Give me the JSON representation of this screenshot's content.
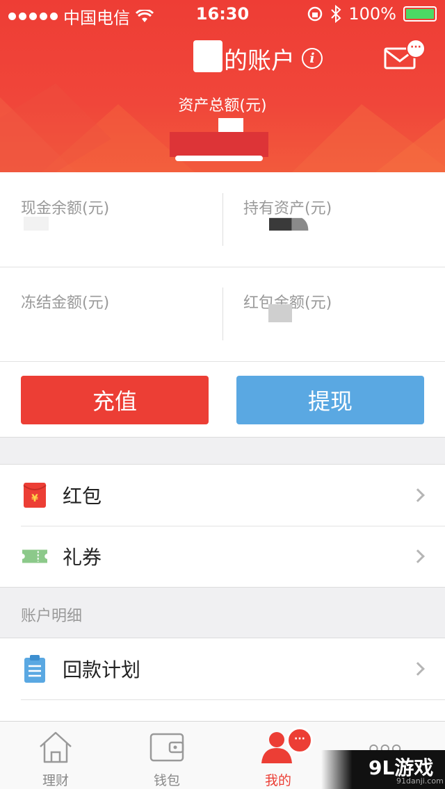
{
  "status_bar": {
    "carrier": "中国电信",
    "time": "16:30",
    "battery": "100%"
  },
  "header": {
    "title": "的账户",
    "info_icon": "i",
    "mail_badge": "···",
    "assets_label": "资产总额(元)"
  },
  "balances": [
    {
      "label": "现金余额(元)"
    },
    {
      "label": "持有资产(元)"
    },
    {
      "label": "冻结金额(元)"
    },
    {
      "label": "红包金额(元)"
    }
  ],
  "actions": {
    "recharge": "充值",
    "withdraw": "提现"
  },
  "list_top": [
    {
      "label": "红包",
      "icon": "red-envelope-icon"
    },
    {
      "label": "礼券",
      "icon": "ticket-icon"
    }
  ],
  "section": {
    "title": "账户明细"
  },
  "list_detail": [
    {
      "label": "回款计划",
      "icon": "clipboard-icon"
    }
  ],
  "tabbar": {
    "tabs": [
      {
        "label": "理财",
        "icon": "home-icon"
      },
      {
        "label": "钱包",
        "icon": "wallet-icon"
      },
      {
        "label": "我的",
        "icon": "user-icon",
        "active": true
      },
      {
        "label": "",
        "icon": "more-icon"
      }
    ],
    "badge": "···"
  },
  "watermark": {
    "logo": "9L游戏",
    "site": "91danji.com"
  },
  "colors": {
    "brand_red": "#ec3e35",
    "withdraw_blue": "#5aa8e2",
    "ticket_green": "#8cc98a"
  }
}
